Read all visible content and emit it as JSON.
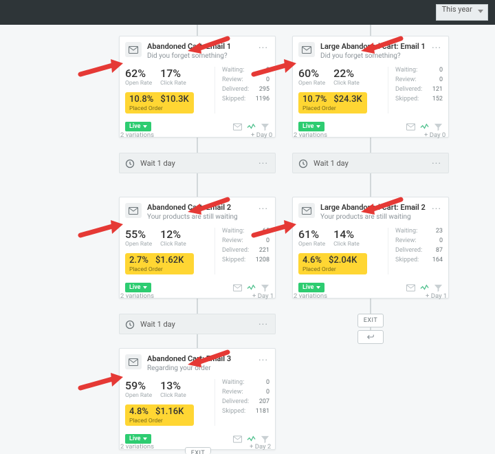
{
  "range_label": "This year",
  "labels": {
    "open_rate": "Open Rate",
    "click_rate": "Click Rate",
    "placed_order": "Placed Order",
    "waiting": "Waiting:",
    "review": "Review:",
    "delivered": "Delivered:",
    "skipped": "Skipped:",
    "live": "Live",
    "variations": "2 variations",
    "wait": "Wait 1 day",
    "exit": "EXIT",
    "day0": "+ Day 0",
    "day1": "+ Day 1",
    "day2": "+ Day 2"
  },
  "cards": [
    {
      "title": "Abandoned Cart: Email 1",
      "sub": "Did you forget something?",
      "open": "62%",
      "click": "17%",
      "placed_pct": "10.8%",
      "placed_val": "$10.3K",
      "waiting": "0",
      "review": "0",
      "delivered": "295",
      "skipped": "1196"
    },
    {
      "title": "Large Abandoned Cart: Email 1",
      "sub": "Did you forget something?",
      "open": "60%",
      "click": "22%",
      "placed_pct": "10.7%",
      "placed_val": "$24.3K",
      "waiting": "0",
      "review": "0",
      "delivered": "121",
      "skipped": "152"
    },
    {
      "title": "Abandoned Cart: Email 2",
      "sub": "Your products are still waiting",
      "open": "55%",
      "click": "12%",
      "placed_pct": "2.7%",
      "placed_val": "$1.62K",
      "waiting": "65",
      "review": "0",
      "delivered": "221",
      "skipped": "1208"
    },
    {
      "title": "Large Abandoned Cart: Email 2",
      "sub": "Your products are still waiting",
      "open": "61%",
      "click": "14%",
      "placed_pct": "4.6%",
      "placed_val": "$2.04K",
      "waiting": "23",
      "review": "0",
      "delivered": "87",
      "skipped": "164"
    },
    {
      "title": "Abandoned Cart: Email 3",
      "sub": "Regarding your order",
      "open": "59%",
      "click": "13%",
      "placed_pct": "4.8%",
      "placed_val": "$1.16K",
      "waiting": "0",
      "review": "0",
      "delivered": "207",
      "skipped": "1181"
    }
  ]
}
